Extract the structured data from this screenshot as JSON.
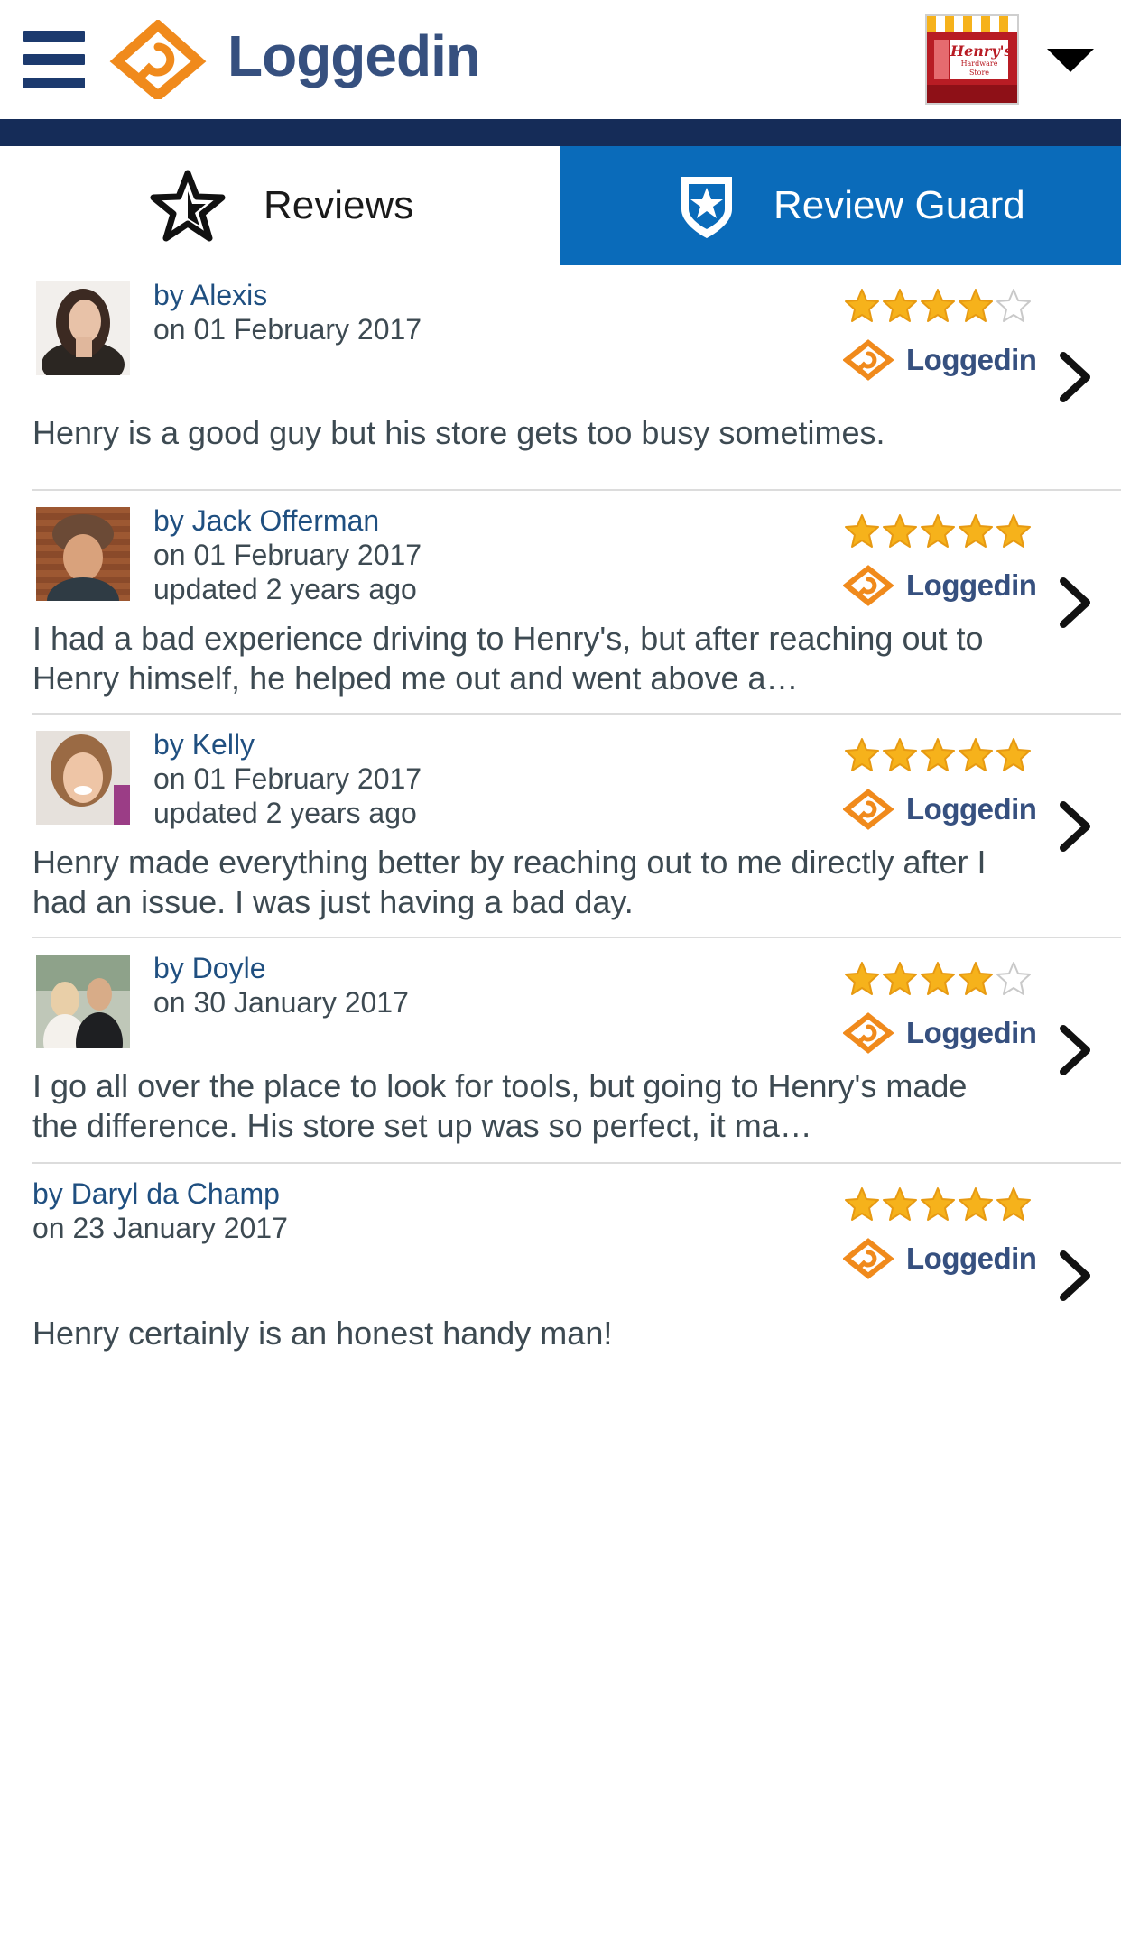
{
  "app": {
    "brand_name": "Loggedin",
    "store_sign": "Henry's",
    "store_sign_sub": "Hardware Store"
  },
  "tabs": [
    {
      "label": "Reviews",
      "icon": "star-outline-icon",
      "active": true
    },
    {
      "label": "Review Guard",
      "icon": "shield-star-icon",
      "active": false
    }
  ],
  "colors": {
    "brand_navy": "#36507f",
    "header_bar": "#152c58",
    "tab_active_bg": "#0a6bba",
    "accent_orange": "#f08a1c",
    "star_gold": "#f6b21b"
  },
  "reviews": [
    {
      "author": "by Alexis",
      "date": "on 01 February 2017",
      "updated": "",
      "rating": 4,
      "source": "Loggedin",
      "text": "Henry is a good guy but his store gets too busy sometimes."
    },
    {
      "author": "by Jack Offerman",
      "date": "on 01 February 2017",
      "updated": "updated 2 years ago",
      "rating": 5,
      "source": "Loggedin",
      "text": "I had a bad experience driving to Henry's,  but after reaching out to Henry himself, he helped me out and went above a…"
    },
    {
      "author": "by Kelly",
      "date": "on 01 February 2017",
      "updated": "updated 2 years ago",
      "rating": 5,
      "source": "Loggedin",
      "text": "Henry made everything better by reaching out to me directly after I had an issue. I was just having a bad day."
    },
    {
      "author": "by Doyle",
      "date": "on 30 January 2017",
      "updated": "",
      "rating": 4,
      "source": "Loggedin",
      "text": "I go all over the place to look for tools, but going to Henry's made the difference. His store set up was so perfect, it ma…"
    },
    {
      "author": "by Daryl da Champ",
      "date": "on 23 January 2017",
      "updated": "",
      "rating": 5,
      "source": "Loggedin",
      "text": "Henry certainly is an honest handy man!"
    }
  ]
}
